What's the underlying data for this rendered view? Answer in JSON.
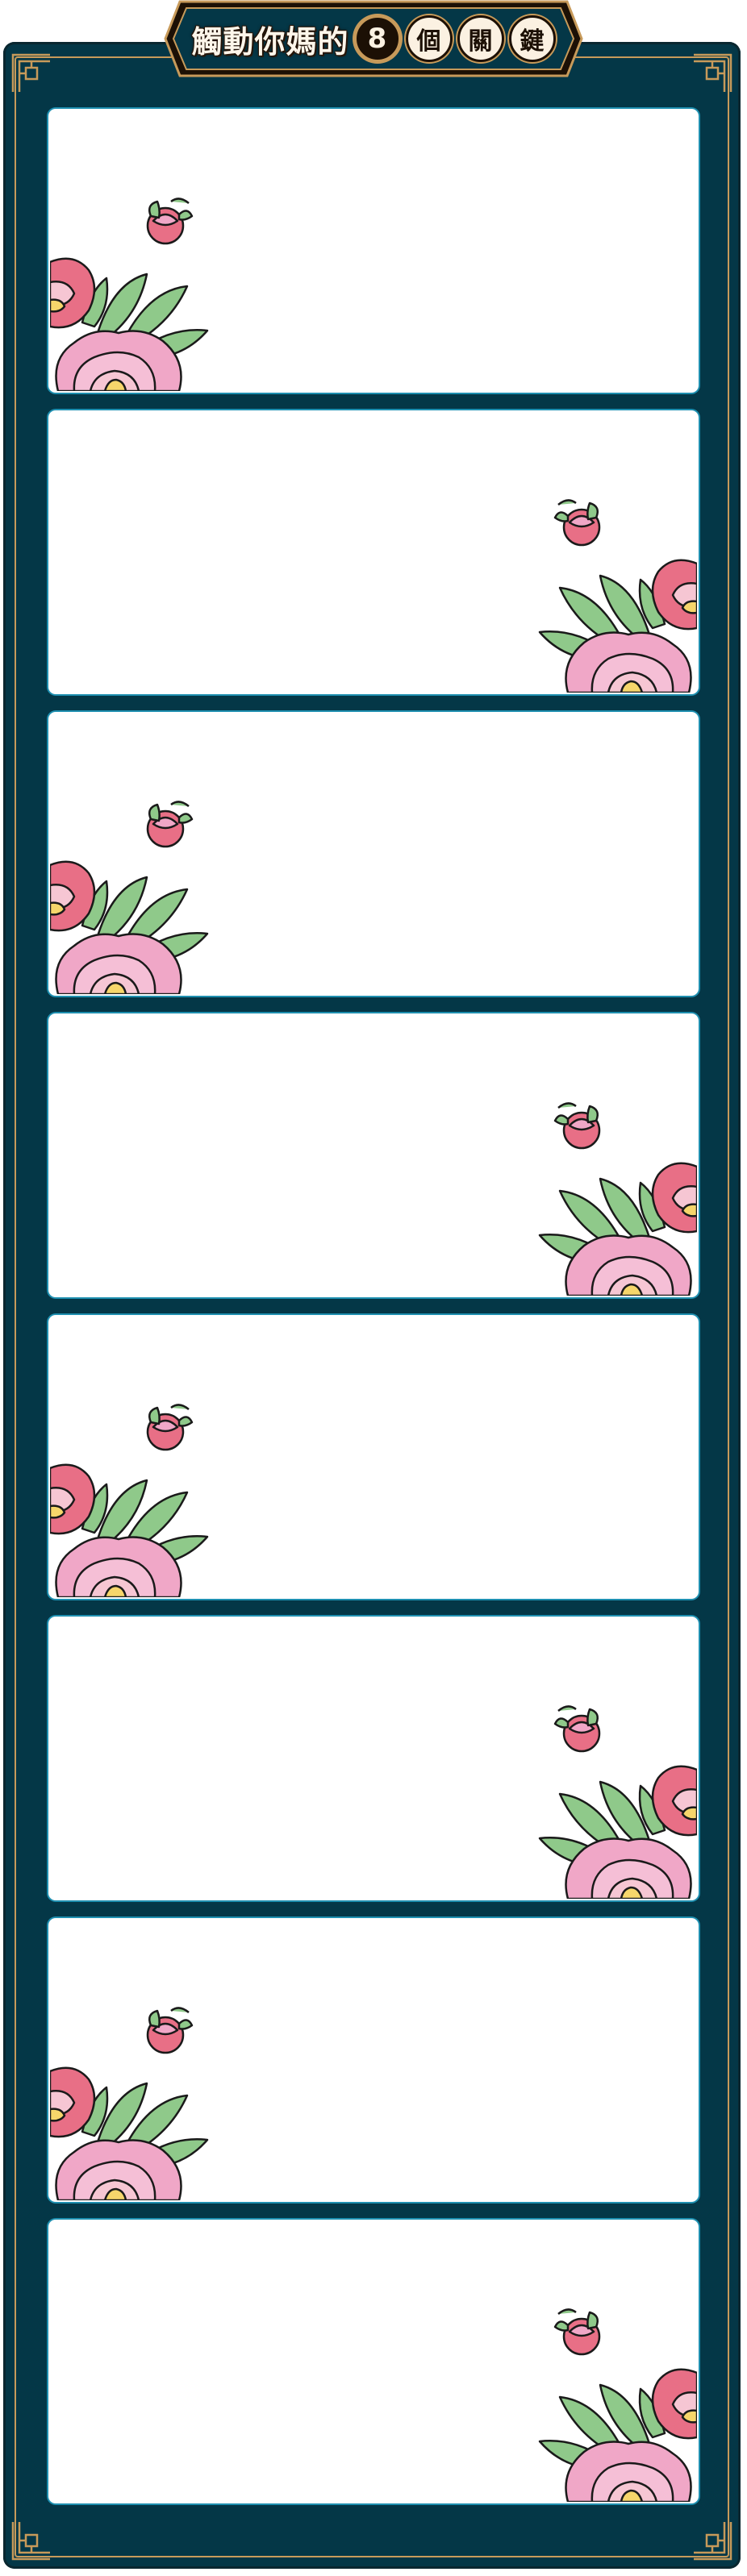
{
  "title": {
    "prefix": "觸動你媽的",
    "number": "8",
    "suffix_chars": [
      "個",
      "關",
      "鍵"
    ]
  },
  "cards": [
    {
      "flower_side": "left"
    },
    {
      "flower_side": "right"
    },
    {
      "flower_side": "left"
    },
    {
      "flower_side": "right"
    },
    {
      "flower_side": "left"
    },
    {
      "flower_side": "right"
    },
    {
      "flower_side": "left"
    },
    {
      "flower_side": "right"
    }
  ],
  "colors": {
    "frame": "#043747",
    "gold_trim": "#c79a5a",
    "card_border": "#1e8fb0",
    "peony_pink": "#f0a7c7",
    "peony_red": "#e86f86",
    "leaf_green": "#8fc98a"
  },
  "icons": [
    "peony-flower-icon",
    "rose-bud-icon",
    "corner-ornament-icon"
  ]
}
